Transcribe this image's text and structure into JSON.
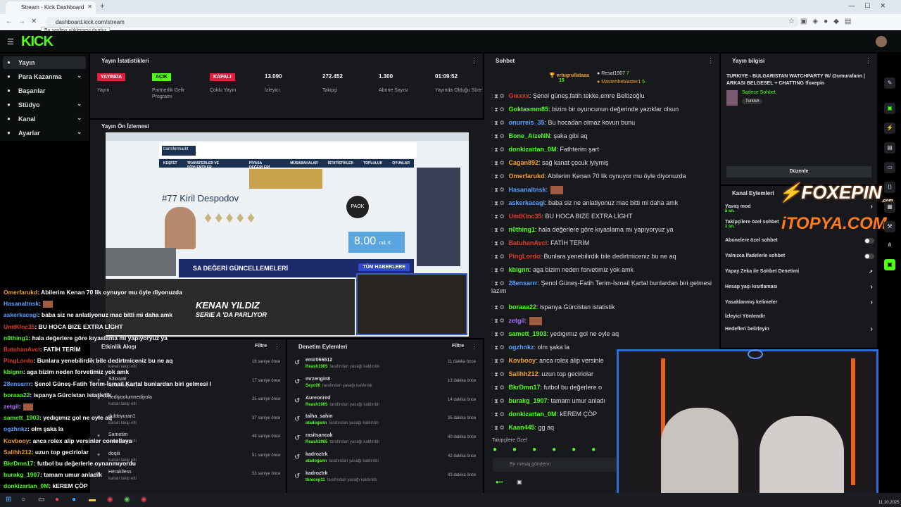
{
  "browser": {
    "tab_title": "Stream - Kick Dashboard",
    "url": "dashboard.kick.com/stream",
    "tooltip": "Bu sayfayı yüklemeyi durdur"
  },
  "brand": {
    "logo": "KICK",
    "accent": "#53fc18"
  },
  "sidebar": {
    "items": [
      {
        "label": "Yayın",
        "icon": "broadcast-icon",
        "chev": false
      },
      {
        "label": "Para Kazanma",
        "icon": "money-icon",
        "chev": true
      },
      {
        "label": "Başarılar",
        "icon": "trophy-icon",
        "chev": false
      },
      {
        "label": "Stüdyo",
        "icon": "studio-icon",
        "chev": true
      },
      {
        "label": "Kanal",
        "icon": "channel-icon",
        "chev": true
      },
      {
        "label": "Ayarlar",
        "icon": "settings-icon",
        "chev": true
      }
    ]
  },
  "stats": {
    "title": "Yayın İstatistikleri",
    "items": [
      {
        "value": "YAYINDA",
        "label": "Yayın",
        "kind": "red"
      },
      {
        "value": "AÇIK",
        "label": "Partnerlik Gelir Programı",
        "kind": "green"
      },
      {
        "value": "KAPALI",
        "label": "Çoklu Yayın",
        "kind": "red"
      },
      {
        "value": "13.090",
        "label": "İzleyici",
        "kind": "num"
      },
      {
        "value": "272.452",
        "label": "Takipçi",
        "kind": "num"
      },
      {
        "value": "1.300",
        "label": "Abone Sayısı",
        "kind": "num"
      },
      {
        "value": "01:09:52",
        "label": "Yayında Olduğu Süre",
        "kind": "num"
      }
    ]
  },
  "preview": {
    "title": "Yayın Ön İzlemesi",
    "site_menu": [
      "KEŞFET",
      "TRANSFERLER VE SÖYLENTİLER",
      "PİYASA DEĞERLERİ",
      "MÜSABAKALAR",
      "İSTATİSTİKLER",
      "TOPLULUK",
      "OYUNLAR"
    ],
    "player": "#77 Kiril Despodov",
    "club": "PAOK",
    "market_value": "8.00",
    "market_unit": "mil. €",
    "banner": "SA DEĞERİ GÜNCELLEMELERİ",
    "banner_btn": "TÜM HABERLERE",
    "headline1": "KENAN YILDIZ",
    "headline2": "SERIE A 'DA PARLIYOR"
  },
  "activity": {
    "title": "Etkinlik Akışı",
    "filter": "Filtre",
    "rows": [
      {
        "name": "",
        "meta": "kanalı takip etti",
        "time": "16 saniye önce"
      },
      {
        "name": "S3xuvar",
        "meta": "kanalı takip etti",
        "time": "17 saniye önce"
      },
      {
        "name": "nediyoolumnediyola",
        "meta": "kanalı takip etti",
        "time": "25 saniye önce"
      },
      {
        "name": "duldoyuran1",
        "meta": "kanalı takip etti",
        "time": "37 saniye önce"
      },
      {
        "name": "Sametim",
        "meta": "kanalı takip etti",
        "time": "48 saniye önce"
      },
      {
        "name": "doqiii",
        "meta": "kanalı takip etti",
        "time": "51 saniye önce"
      },
      {
        "name": "Heraklless",
        "meta": "kanalı takip etti",
        "time": "53 saniye önce"
      }
    ]
  },
  "moderation": {
    "title": "Denetim Eylemleri",
    "filter": "Filtre",
    "rows": [
      {
        "user": "emir066612",
        "by": "Reash1905",
        "action": "tarafından yasağı kaldırıldı",
        "time": "11 dakika önce"
      },
      {
        "user": "mrzengin8",
        "by": "Seyo06",
        "action": "tarafından yasağı kaldırıldı",
        "time": "13 dakika önce"
      },
      {
        "user": "Aureonred",
        "by": "Reash1905",
        "action": "tarafından yasağı kaldırıldı",
        "time": "14 dakika önce"
      },
      {
        "user": "talha_sahin",
        "by": "atadogann",
        "action": "tarafından yasağı kaldırıldı",
        "time": "35 dakika önce"
      },
      {
        "user": "rasitsancak",
        "by": "Reash1905",
        "action": "tarafından yasağı kaldırıldı",
        "time": "40 dakika önce"
      },
      {
        "user": "kadroztrk",
        "by": "atadogann",
        "action": "tarafından yasağı kaldırıldı",
        "time": "42 dakika önce"
      },
      {
        "user": "kadroztrk",
        "by": "tkrecep11",
        "action": "tarafından yasağı kaldırıldı",
        "time": "43 dakika önce"
      }
    ]
  },
  "chat": {
    "title": "Sohbet",
    "top": [
      {
        "name": "ertugrullataaa",
        "n": "15"
      },
      {
        "name": "Resat1907",
        "n": "7"
      },
      {
        "name": "Mastertheblaster1",
        "n": "5"
      }
    ],
    "messages": [
      {
        "user": "Gıxxxx",
        "color": "#e0392b",
        "text": ": Şenol güneş,fatih tekke,emre Belözoğlu"
      },
      {
        "user": "Goktasmm85",
        "color": "#53fc18",
        "text": ": bizim bir oyuncunun değerinde yazıklar olsun"
      },
      {
        "user": "onurreis_35",
        "color": "#5aa0ff",
        "text": ": Bu hocadan olmaz kovun bunu"
      },
      {
        "user": "Bone_AizeNN",
        "color": "#53fc18",
        "text": ": şaka gibi aq"
      },
      {
        "user": "donkizartan_0M",
        "color": "#53fc18",
        "text": ": Fathterim şart"
      },
      {
        "user": "Cagan892",
        "color": "#f0a030",
        "text": ": sağ kanat çocuk iyiymiş"
      },
      {
        "user": "Omerfarukd",
        "color": "#f0a030",
        "text": ": Abilerim Kenan 70 lik oynuyor mu öyle diyonuzda"
      },
      {
        "user": "Hasanaltnsk",
        "color": "#5aa0ff",
        "text": ":"
      },
      {
        "user": "askerkacagi",
        "color": "#5aa0ff",
        "text": ": baba siz ne anlatiyonuz mac bitti mi daha amk"
      },
      {
        "user": "UmtKlnc35",
        "color": "#e0392b",
        "text": ": BU HOCA BIZE EXTRA LİGHT"
      },
      {
        "user": "n0thing1",
        "color": "#53fc18",
        "text": ": hala değerlere göre kıyaslama mı yapıyoryuz ya"
      },
      {
        "user": "BatuhanAvci",
        "color": "#e0392b",
        "text": ": FATİH TERİM"
      },
      {
        "user": "PingLordo",
        "color": "#e0392b",
        "text": ": Bunlara yenebilirdik bile dedirtmiceniz bu ne aq"
      },
      {
        "user": "kbignn",
        "color": "#53fc18",
        "text": ": aga bizim neden forvetimiz yok amk"
      },
      {
        "user": "28ensarrr",
        "color": "#5aa0ff",
        "text": ": Şenol Güneş-Fatih Terim-İsmail Kartal bunlardan biri gelmesi lazım"
      },
      {
        "user": "boraaa22",
        "color": "#53fc18",
        "text": ": ispanya Gürcistan istatistik"
      },
      {
        "user": "zetgil",
        "color": "#b070ff",
        "text": ":"
      },
      {
        "user": "samett_1903",
        "color": "#53fc18",
        "text": ": yedıgımız gol ne oyle aq"
      },
      {
        "user": "ogzhnkz",
        "color": "#5aa0ff",
        "text": ": olm şaka la"
      },
      {
        "user": "Kovbooy",
        "color": "#f0a030",
        "text": ": anca rolex alip versinle"
      },
      {
        "user": "Salihh212",
        "color": "#f0a030",
        "text": ": uzun top geciriolar"
      },
      {
        "user": "BkrDmn17",
        "color": "#53fc18",
        "text": ": futbol bu değerlere o"
      },
      {
        "user": "burakg_1907",
        "color": "#53fc18",
        "text": ": tamam umur anladı"
      },
      {
        "user": "donkizartan_0M",
        "color": "#53fc18",
        "text": ": kEREM ÇÖP"
      },
      {
        "user": "Kaan445",
        "color": "#53fc18",
        "text": ": gg aq"
      }
    ],
    "emote_label": "Takipçilere Özel",
    "input_placeholder": "Bir mesaj gönderin"
  },
  "stream_info": {
    "title": "Yayın bilgisi",
    "stream_title": "TURKIYE - BULGARISTAN WATCHPARTY W/ @umurafann | ARKASI BELGESEL + CHATTING !foxepin",
    "mode": "Sadece Sohbet",
    "tag": "Turkish",
    "edit": "Düzenle"
  },
  "channel": {
    "title": "Kanal Eylemleri",
    "rows": [
      {
        "label": "Yavaş mod",
        "sub": "5 sn.",
        "type": "arrow"
      },
      {
        "label": "Takipçilere özel sohbet",
        "sub": "1 sn.",
        "type": "arrow"
      },
      {
        "label": "Abonelere özel sohbet",
        "sub": "",
        "type": "toggle"
      },
      {
        "label": "Yalnızca İfadelerle sohbet",
        "sub": "",
        "type": "toggle"
      },
      {
        "label": "Yapay Zeka ile Sohbet Denetimi",
        "sub": "",
        "type": "ext"
      },
      {
        "label": "Hesap yaşı kısıtlaması",
        "sub": "",
        "type": "arrow"
      },
      {
        "label": "Yasaklanmış kelimeler",
        "sub": "",
        "type": "arrow"
      },
      {
        "label": "İzleyici Yönlendir",
        "sub": "",
        "type": "none"
      },
      {
        "label": "Hedefleri belirleyin",
        "sub": "",
        "type": "arrow"
      }
    ]
  },
  "sponsors": {
    "s1": "FOXEPIN",
    "s1_sub": ".com",
    "s2": "iTOPYA.COM"
  },
  "overlay_chat": [
    {
      "user": "Omerfarukd",
      "color": "#f0a030",
      "text": ": Abilerim Kenan 70 lik oynuyor mu öyle diyonuzda"
    },
    {
      "user": "Hasanaltnsk",
      "color": "#5aa0ff",
      "text": ":"
    },
    {
      "user": "askerkacagi",
      "color": "#5aa0ff",
      "text": ": baba siz ne anlatiyonuz mac bitti mi daha amk"
    },
    {
      "user": "UmtKlnc35",
      "color": "#e0392b",
      "text": ": BU HOCA BIZE EXTRA LİGHT"
    },
    {
      "user": "n0thing1",
      "color": "#53fc18",
      "text": ": hala değerlere göre kıyaslama mı yapıyoryuz ya"
    },
    {
      "user": "BatuhanAvci",
      "color": "#e0392b",
      "text": ": FATİH TERİM"
    },
    {
      "user": "PingLordo",
      "color": "#e0392b",
      "text": ": Bunlara yenebilirdik bile dedirtmiceniz bu ne aq"
    },
    {
      "user": "kbignn",
      "color": "#53fc18",
      "text": ": aga bizim neden forvetimiz yok amk"
    },
    {
      "user": "28ensarrr",
      "color": "#5aa0ff",
      "text": ": Şenol Güneş-Fatih Terim-İsmail Kartal bunlardan biri gelmesi l"
    },
    {
      "user": "boraaa22",
      "color": "#53fc18",
      "text": ": ispanya Gürcistan istatistik"
    },
    {
      "user": "zetgil",
      "color": "#b070ff",
      "text": ":"
    },
    {
      "user": "samett_1903",
      "color": "#53fc18",
      "text": ": yedıgımız gol ne oyle aq"
    },
    {
      "user": "ogzhnkz",
      "color": "#5aa0ff",
      "text": ": olm şaka la"
    },
    {
      "user": "Kovbooy",
      "color": "#f0a030",
      "text": ": anca rolex alip versinler contellaya"
    },
    {
      "user": "Salihh212",
      "color": "#f0a030",
      "text": ": uzun top geciriolar"
    },
    {
      "user": "BkrDmn17",
      "color": "#53fc18",
      "text": ": futbol bu değerlerle oynanmıyordu"
    },
    {
      "user": "burakg_1907",
      "color": "#53fc18",
      "text": ": tamam umur anladık"
    },
    {
      "user": "donkizartan_0M",
      "color": "#53fc18",
      "text": ": kEREM ÇÖP"
    }
  ],
  "taskbar": {
    "time": "11.10.2025"
  }
}
